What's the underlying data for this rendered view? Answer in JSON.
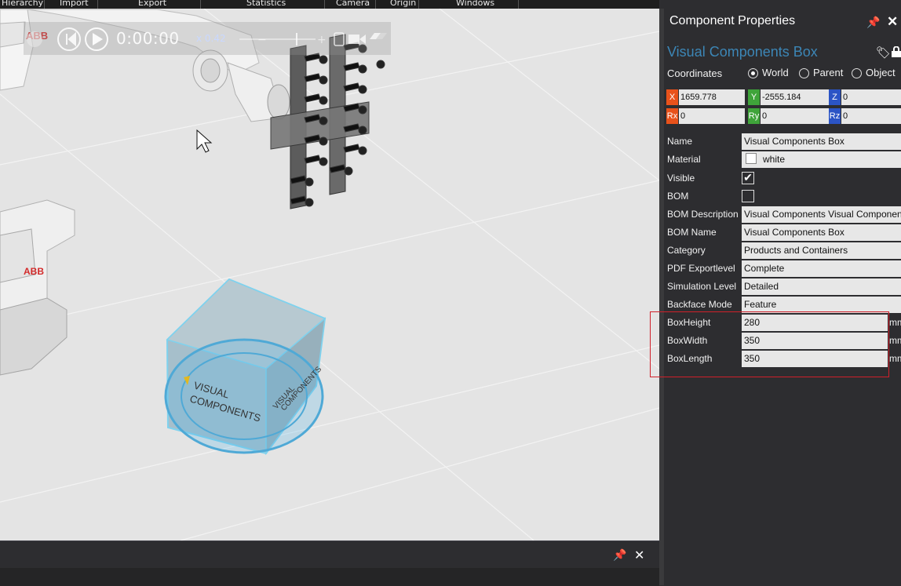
{
  "menu": {
    "items": [
      "Hierarchy",
      "Import",
      "Export",
      "Statistics",
      "Camera",
      "Origin",
      "Windows"
    ]
  },
  "playback": {
    "time": "0:00:00",
    "speed": "x 0.42"
  },
  "viewport": {
    "box_logo_front": [
      "VISUAL",
      "COMPONENTS"
    ],
    "box_logo_side": [
      "VISUAL",
      "COMPONENTS"
    ],
    "robot_brand": "ABB"
  },
  "properties": {
    "panel_title": "Component Properties",
    "component_name": "Visual Components Box",
    "coordinates_label": "Coordinates",
    "coord_modes": [
      {
        "label": "World",
        "selected": true
      },
      {
        "label": "Parent",
        "selected": false
      },
      {
        "label": "Object",
        "selected": false
      }
    ],
    "coords": {
      "x": {
        "tag": "X",
        "value": "1659.778",
        "color": "#e8521b"
      },
      "y": {
        "tag": "Y",
        "value": "-2555.184",
        "color": "#3fa43a"
      },
      "z": {
        "tag": "Z",
        "value": "0",
        "color": "#2b54c5"
      },
      "rx": {
        "tag": "Rx",
        "value": "0",
        "color": "#e8521b"
      },
      "ry": {
        "tag": "Ry",
        "value": "0",
        "color": "#3fa43a"
      },
      "rz": {
        "tag": "Rz",
        "value": "0",
        "color": "#2b54c5"
      }
    },
    "rows": {
      "name": {
        "label": "Name",
        "value": "Visual Components Box"
      },
      "material": {
        "label": "Material",
        "value": "white"
      },
      "visible": {
        "label": "Visible",
        "checked": true
      },
      "bom": {
        "label": "BOM",
        "checked": false
      },
      "bom_description": {
        "label": "BOM Description",
        "value": "Visual Components Visual Components"
      },
      "bom_name": {
        "label": "BOM Name",
        "value": "Visual Components Box"
      },
      "category": {
        "label": "Category",
        "value": "Products and Containers"
      },
      "pdf_exportlevel": {
        "label": "PDF Exportlevel",
        "value": "Complete"
      },
      "simulation_level": {
        "label": "Simulation Level",
        "value": "Detailed"
      },
      "backface_mode": {
        "label": "Backface Mode",
        "value": "Feature"
      },
      "box_height": {
        "label": "BoxHeight",
        "value": "280",
        "unit": "mm"
      },
      "box_width": {
        "label": "BoxWidth",
        "value": "350",
        "unit": "mm"
      },
      "box_length": {
        "label": "BoxLength",
        "value": "350",
        "unit": "mm"
      }
    }
  },
  "colors": {
    "panel_bg": "#2d2d30",
    "accent_name": "#3c86b6",
    "highlight": "#d0202a"
  }
}
